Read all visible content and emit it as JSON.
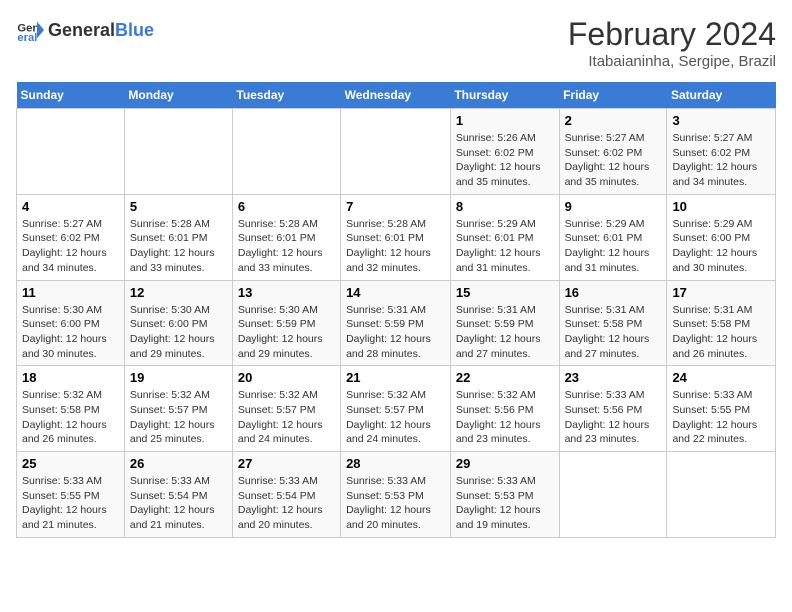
{
  "header": {
    "logo_general": "General",
    "logo_blue": "Blue",
    "title": "February 2024",
    "subtitle": "Itabaianinha, Sergipe, Brazil"
  },
  "calendar": {
    "days_of_week": [
      "Sunday",
      "Monday",
      "Tuesday",
      "Wednesday",
      "Thursday",
      "Friday",
      "Saturday"
    ],
    "weeks": [
      [
        {
          "day": "",
          "detail": ""
        },
        {
          "day": "",
          "detail": ""
        },
        {
          "day": "",
          "detail": ""
        },
        {
          "day": "",
          "detail": ""
        },
        {
          "day": "1",
          "detail": "Sunrise: 5:26 AM\nSunset: 6:02 PM\nDaylight: 12 hours\nand 35 minutes."
        },
        {
          "day": "2",
          "detail": "Sunrise: 5:27 AM\nSunset: 6:02 PM\nDaylight: 12 hours\nand 35 minutes."
        },
        {
          "day": "3",
          "detail": "Sunrise: 5:27 AM\nSunset: 6:02 PM\nDaylight: 12 hours\nand 34 minutes."
        }
      ],
      [
        {
          "day": "4",
          "detail": "Sunrise: 5:27 AM\nSunset: 6:02 PM\nDaylight: 12 hours\nand 34 minutes."
        },
        {
          "day": "5",
          "detail": "Sunrise: 5:28 AM\nSunset: 6:01 PM\nDaylight: 12 hours\nand 33 minutes."
        },
        {
          "day": "6",
          "detail": "Sunrise: 5:28 AM\nSunset: 6:01 PM\nDaylight: 12 hours\nand 33 minutes."
        },
        {
          "day": "7",
          "detail": "Sunrise: 5:28 AM\nSunset: 6:01 PM\nDaylight: 12 hours\nand 32 minutes."
        },
        {
          "day": "8",
          "detail": "Sunrise: 5:29 AM\nSunset: 6:01 PM\nDaylight: 12 hours\nand 31 minutes."
        },
        {
          "day": "9",
          "detail": "Sunrise: 5:29 AM\nSunset: 6:01 PM\nDaylight: 12 hours\nand 31 minutes."
        },
        {
          "day": "10",
          "detail": "Sunrise: 5:29 AM\nSunset: 6:00 PM\nDaylight: 12 hours\nand 30 minutes."
        }
      ],
      [
        {
          "day": "11",
          "detail": "Sunrise: 5:30 AM\nSunset: 6:00 PM\nDaylight: 12 hours\nand 30 minutes."
        },
        {
          "day": "12",
          "detail": "Sunrise: 5:30 AM\nSunset: 6:00 PM\nDaylight: 12 hours\nand 29 minutes."
        },
        {
          "day": "13",
          "detail": "Sunrise: 5:30 AM\nSunset: 5:59 PM\nDaylight: 12 hours\nand 29 minutes."
        },
        {
          "day": "14",
          "detail": "Sunrise: 5:31 AM\nSunset: 5:59 PM\nDaylight: 12 hours\nand 28 minutes."
        },
        {
          "day": "15",
          "detail": "Sunrise: 5:31 AM\nSunset: 5:59 PM\nDaylight: 12 hours\nand 27 minutes."
        },
        {
          "day": "16",
          "detail": "Sunrise: 5:31 AM\nSunset: 5:58 PM\nDaylight: 12 hours\nand 27 minutes."
        },
        {
          "day": "17",
          "detail": "Sunrise: 5:31 AM\nSunset: 5:58 PM\nDaylight: 12 hours\nand 26 minutes."
        }
      ],
      [
        {
          "day": "18",
          "detail": "Sunrise: 5:32 AM\nSunset: 5:58 PM\nDaylight: 12 hours\nand 26 minutes."
        },
        {
          "day": "19",
          "detail": "Sunrise: 5:32 AM\nSunset: 5:57 PM\nDaylight: 12 hours\nand 25 minutes."
        },
        {
          "day": "20",
          "detail": "Sunrise: 5:32 AM\nSunset: 5:57 PM\nDaylight: 12 hours\nand 24 minutes."
        },
        {
          "day": "21",
          "detail": "Sunrise: 5:32 AM\nSunset: 5:57 PM\nDaylight: 12 hours\nand 24 minutes."
        },
        {
          "day": "22",
          "detail": "Sunrise: 5:32 AM\nSunset: 5:56 PM\nDaylight: 12 hours\nand 23 minutes."
        },
        {
          "day": "23",
          "detail": "Sunrise: 5:33 AM\nSunset: 5:56 PM\nDaylight: 12 hours\nand 23 minutes."
        },
        {
          "day": "24",
          "detail": "Sunrise: 5:33 AM\nSunset: 5:55 PM\nDaylight: 12 hours\nand 22 minutes."
        }
      ],
      [
        {
          "day": "25",
          "detail": "Sunrise: 5:33 AM\nSunset: 5:55 PM\nDaylight: 12 hours\nand 21 minutes."
        },
        {
          "day": "26",
          "detail": "Sunrise: 5:33 AM\nSunset: 5:54 PM\nDaylight: 12 hours\nand 21 minutes."
        },
        {
          "day": "27",
          "detail": "Sunrise: 5:33 AM\nSunset: 5:54 PM\nDaylight: 12 hours\nand 20 minutes."
        },
        {
          "day": "28",
          "detail": "Sunrise: 5:33 AM\nSunset: 5:53 PM\nDaylight: 12 hours\nand 20 minutes."
        },
        {
          "day": "29",
          "detail": "Sunrise: 5:33 AM\nSunset: 5:53 PM\nDaylight: 12 hours\nand 19 minutes."
        },
        {
          "day": "",
          "detail": ""
        },
        {
          "day": "",
          "detail": ""
        }
      ]
    ]
  }
}
